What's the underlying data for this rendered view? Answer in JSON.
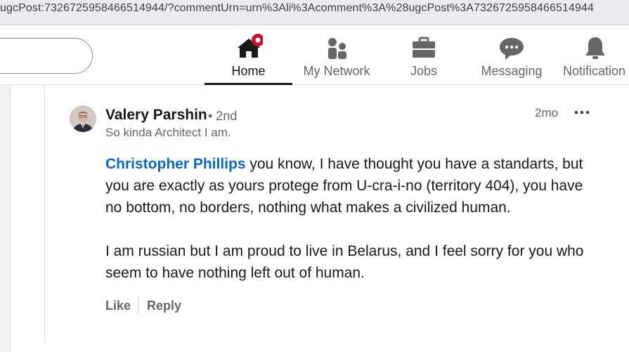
{
  "browser": {
    "url": "ugcPost:7326725958466514944/?commentUrn=urn%3Ali%3Acomment%3A%28ugcPost%3A7326725958466514944"
  },
  "nav": {
    "items": [
      {
        "label": "Home",
        "icon": "home-icon",
        "active": true,
        "badge_color": "#cb112d"
      },
      {
        "label": "My Network",
        "icon": "people-icon"
      },
      {
        "label": "Jobs",
        "icon": "briefcase-icon"
      },
      {
        "label": "Messaging",
        "icon": "messaging-icon"
      },
      {
        "label": "Notification",
        "icon": "bell-icon"
      }
    ]
  },
  "comment": {
    "author": "Valery Parshin",
    "degree": "• 2nd",
    "headline": "So kinda Architect I am.",
    "time": "2mo",
    "mention": "Christopher Phillips",
    "text_after_mention": " you know, I have thought you have a standarts, but you are exactly as yours protege from U-cra-i-no (territory 404), you have no bottom, no borders, nothing what makes a civilized human.",
    "paragraph2": "I am russian but I am proud to live in Belarus, and I feel sorry for you who seem to have nothing left out of human.",
    "like_label": "Like",
    "reply_label": "Reply"
  },
  "colors": {
    "link": "#0a66c2",
    "muted": "#666666",
    "text": "#191919"
  }
}
